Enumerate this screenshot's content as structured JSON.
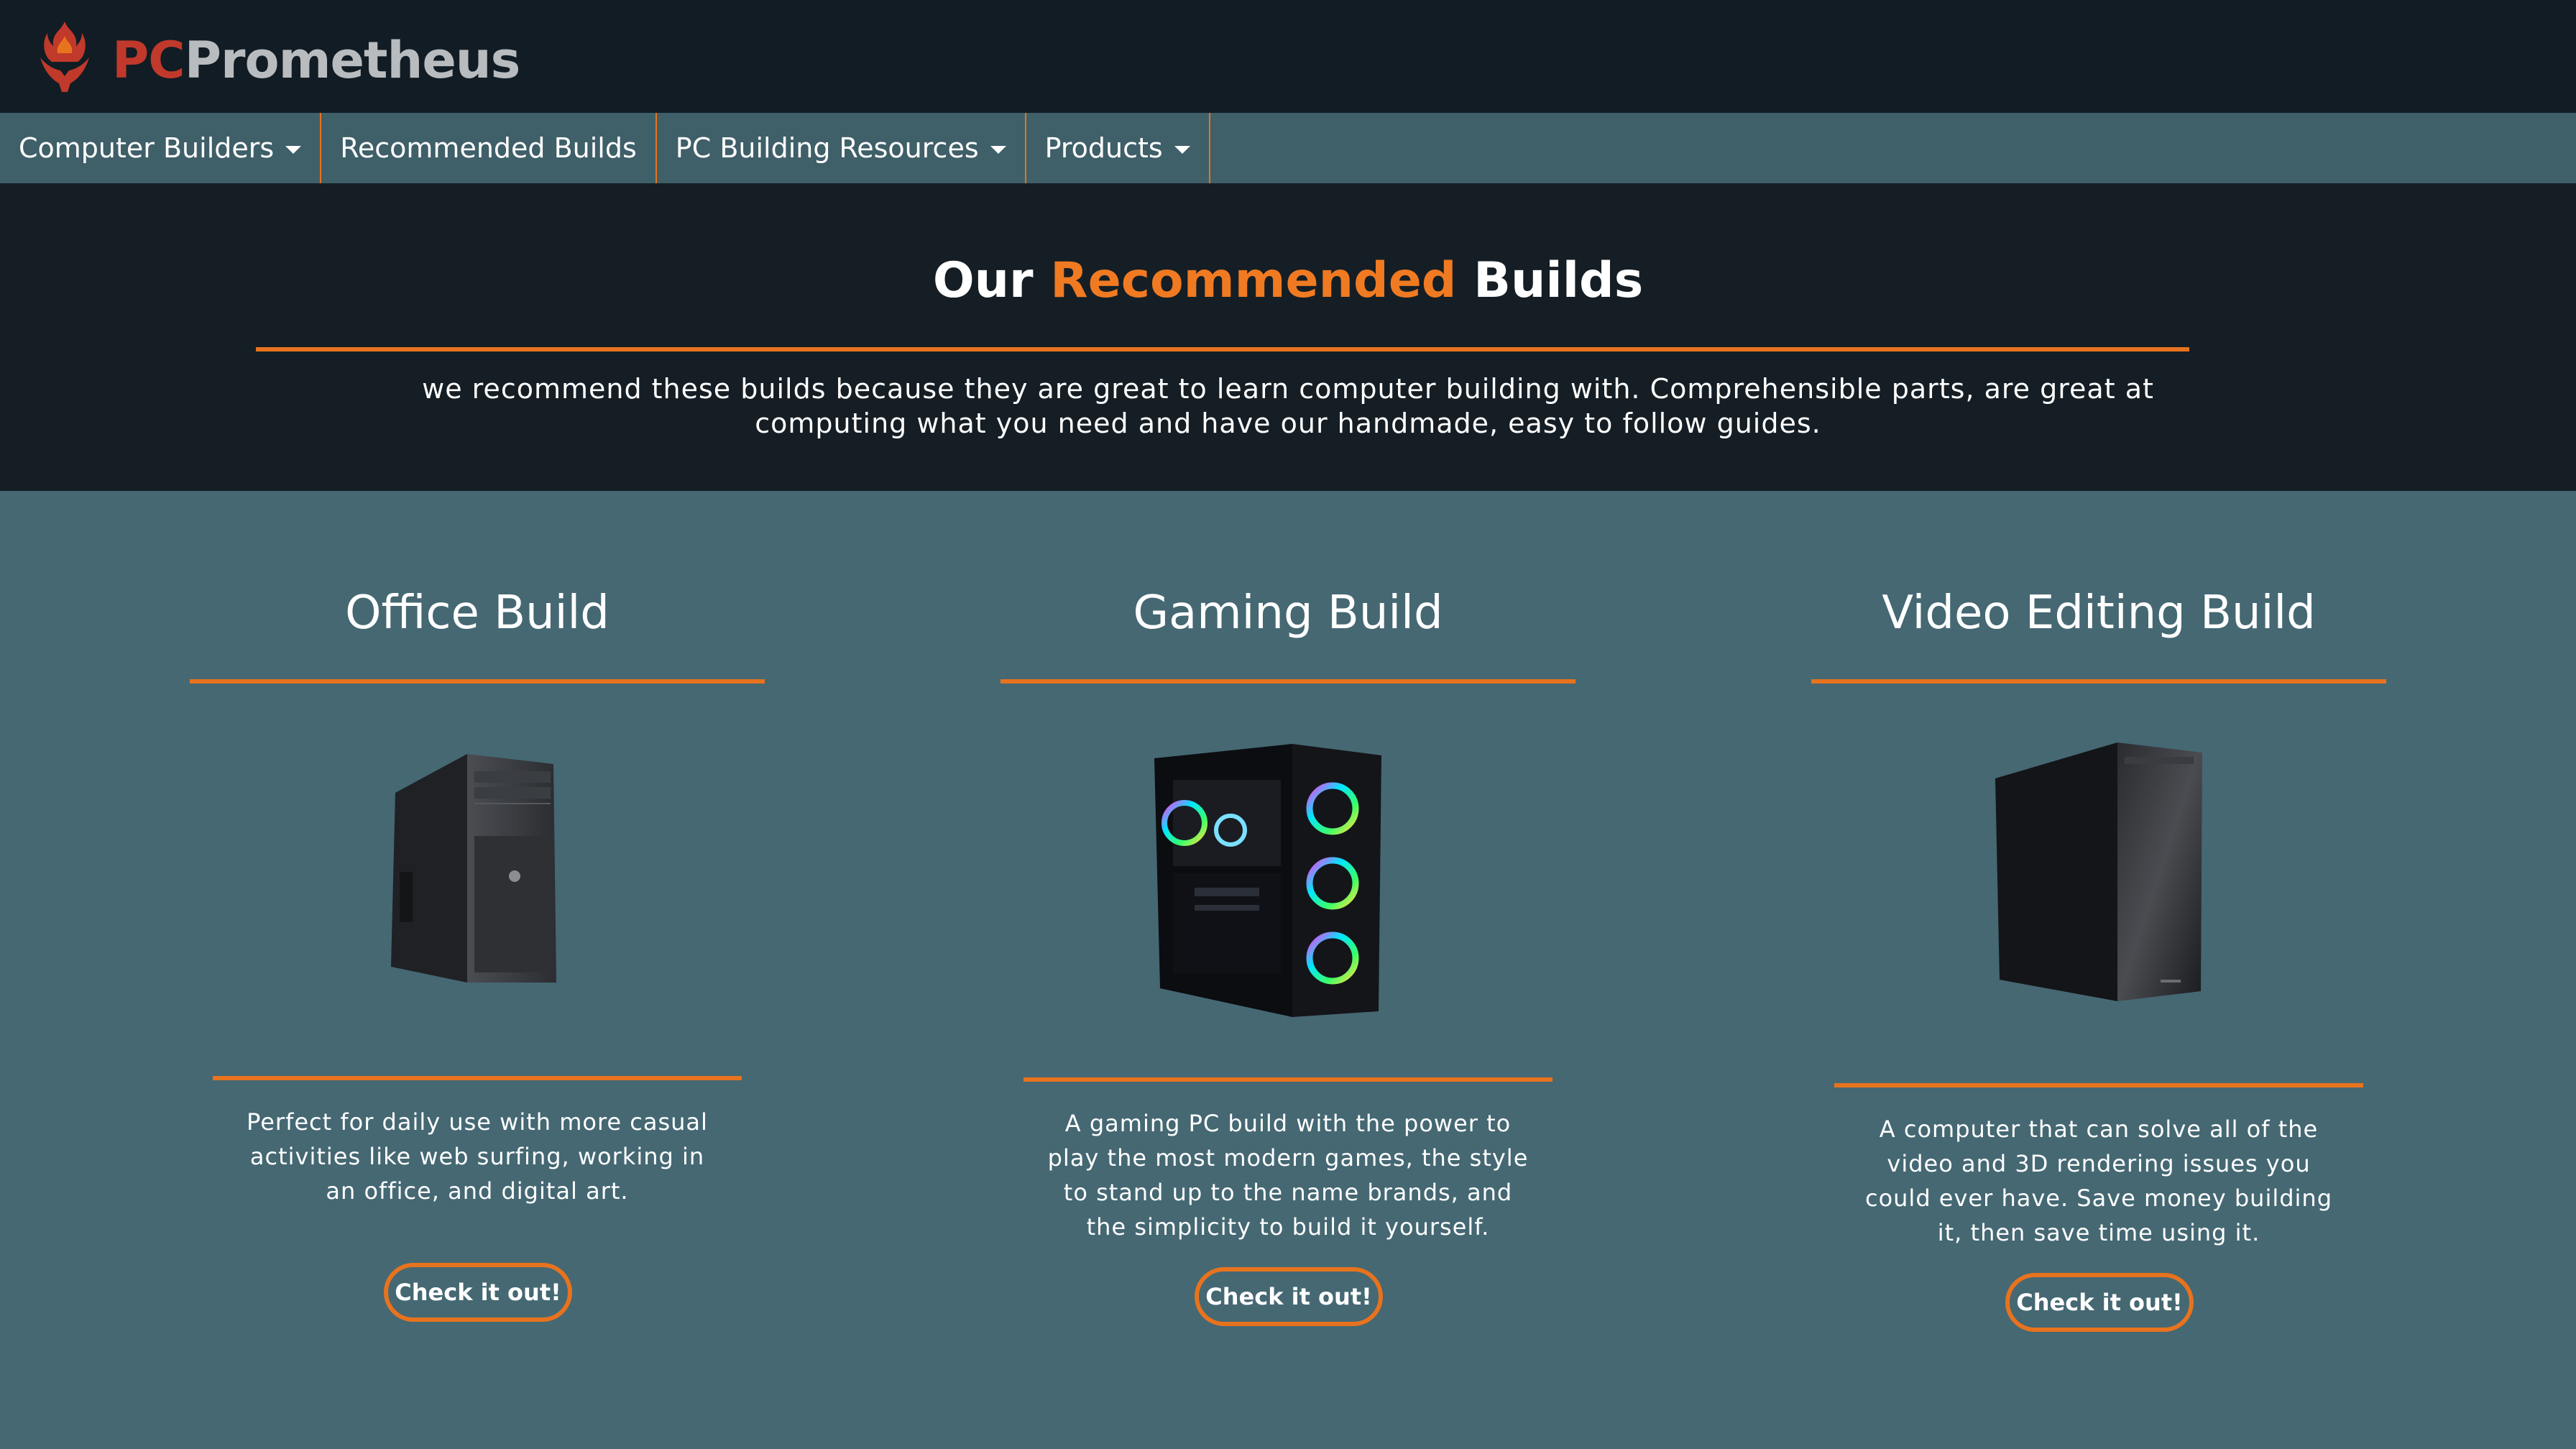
{
  "brand": {
    "prefix": "PC",
    "name": "Prometheus",
    "colors": {
      "prefix": "#c0392b",
      "name": "#b9bcbf"
    },
    "logo_icon": "flame-hands-icon"
  },
  "nav": {
    "items": [
      {
        "label": "Computer Builders",
        "dropdown": true
      },
      {
        "label": "Recommended Builds",
        "dropdown": false
      },
      {
        "label": "PC Building Resources",
        "dropdown": true
      },
      {
        "label": "Products",
        "dropdown": true
      }
    ]
  },
  "hero": {
    "title_part1": "Our",
    "title_accent": "Recommended",
    "title_part2": "Builds",
    "description": "we recommend these builds because they are great to learn computer building with. Comprehensible parts, are great at computing what you need and have our handmade, easy to follow guides."
  },
  "builds": [
    {
      "title": "Office Build",
      "description": "Perfect for daily use with more casual activities like web surfing, working in an office, and digital art.",
      "button": "Check it out!",
      "image": "office-pc-case-image"
    },
    {
      "title": "Gaming Build",
      "description": "A gaming PC build with the power to play the most modern games, the style to stand up to the name brands, and the simplicity to build it yourself.",
      "button": "Check it out!",
      "image": "gaming-pc-case-image"
    },
    {
      "title": "Video Editing Build",
      "description": "A computer that can solve all of the video and 3D rendering issues you could ever have. Save money building it, then save time using it.",
      "button": "Check it out!",
      "image": "video-editing-pc-case-image"
    }
  ],
  "colors": {
    "accent": "#e8731e",
    "header_bg": "#111c24",
    "nav_bg": "#3f5f69",
    "hero_bg": "#151e24",
    "content_bg": "#456873"
  }
}
